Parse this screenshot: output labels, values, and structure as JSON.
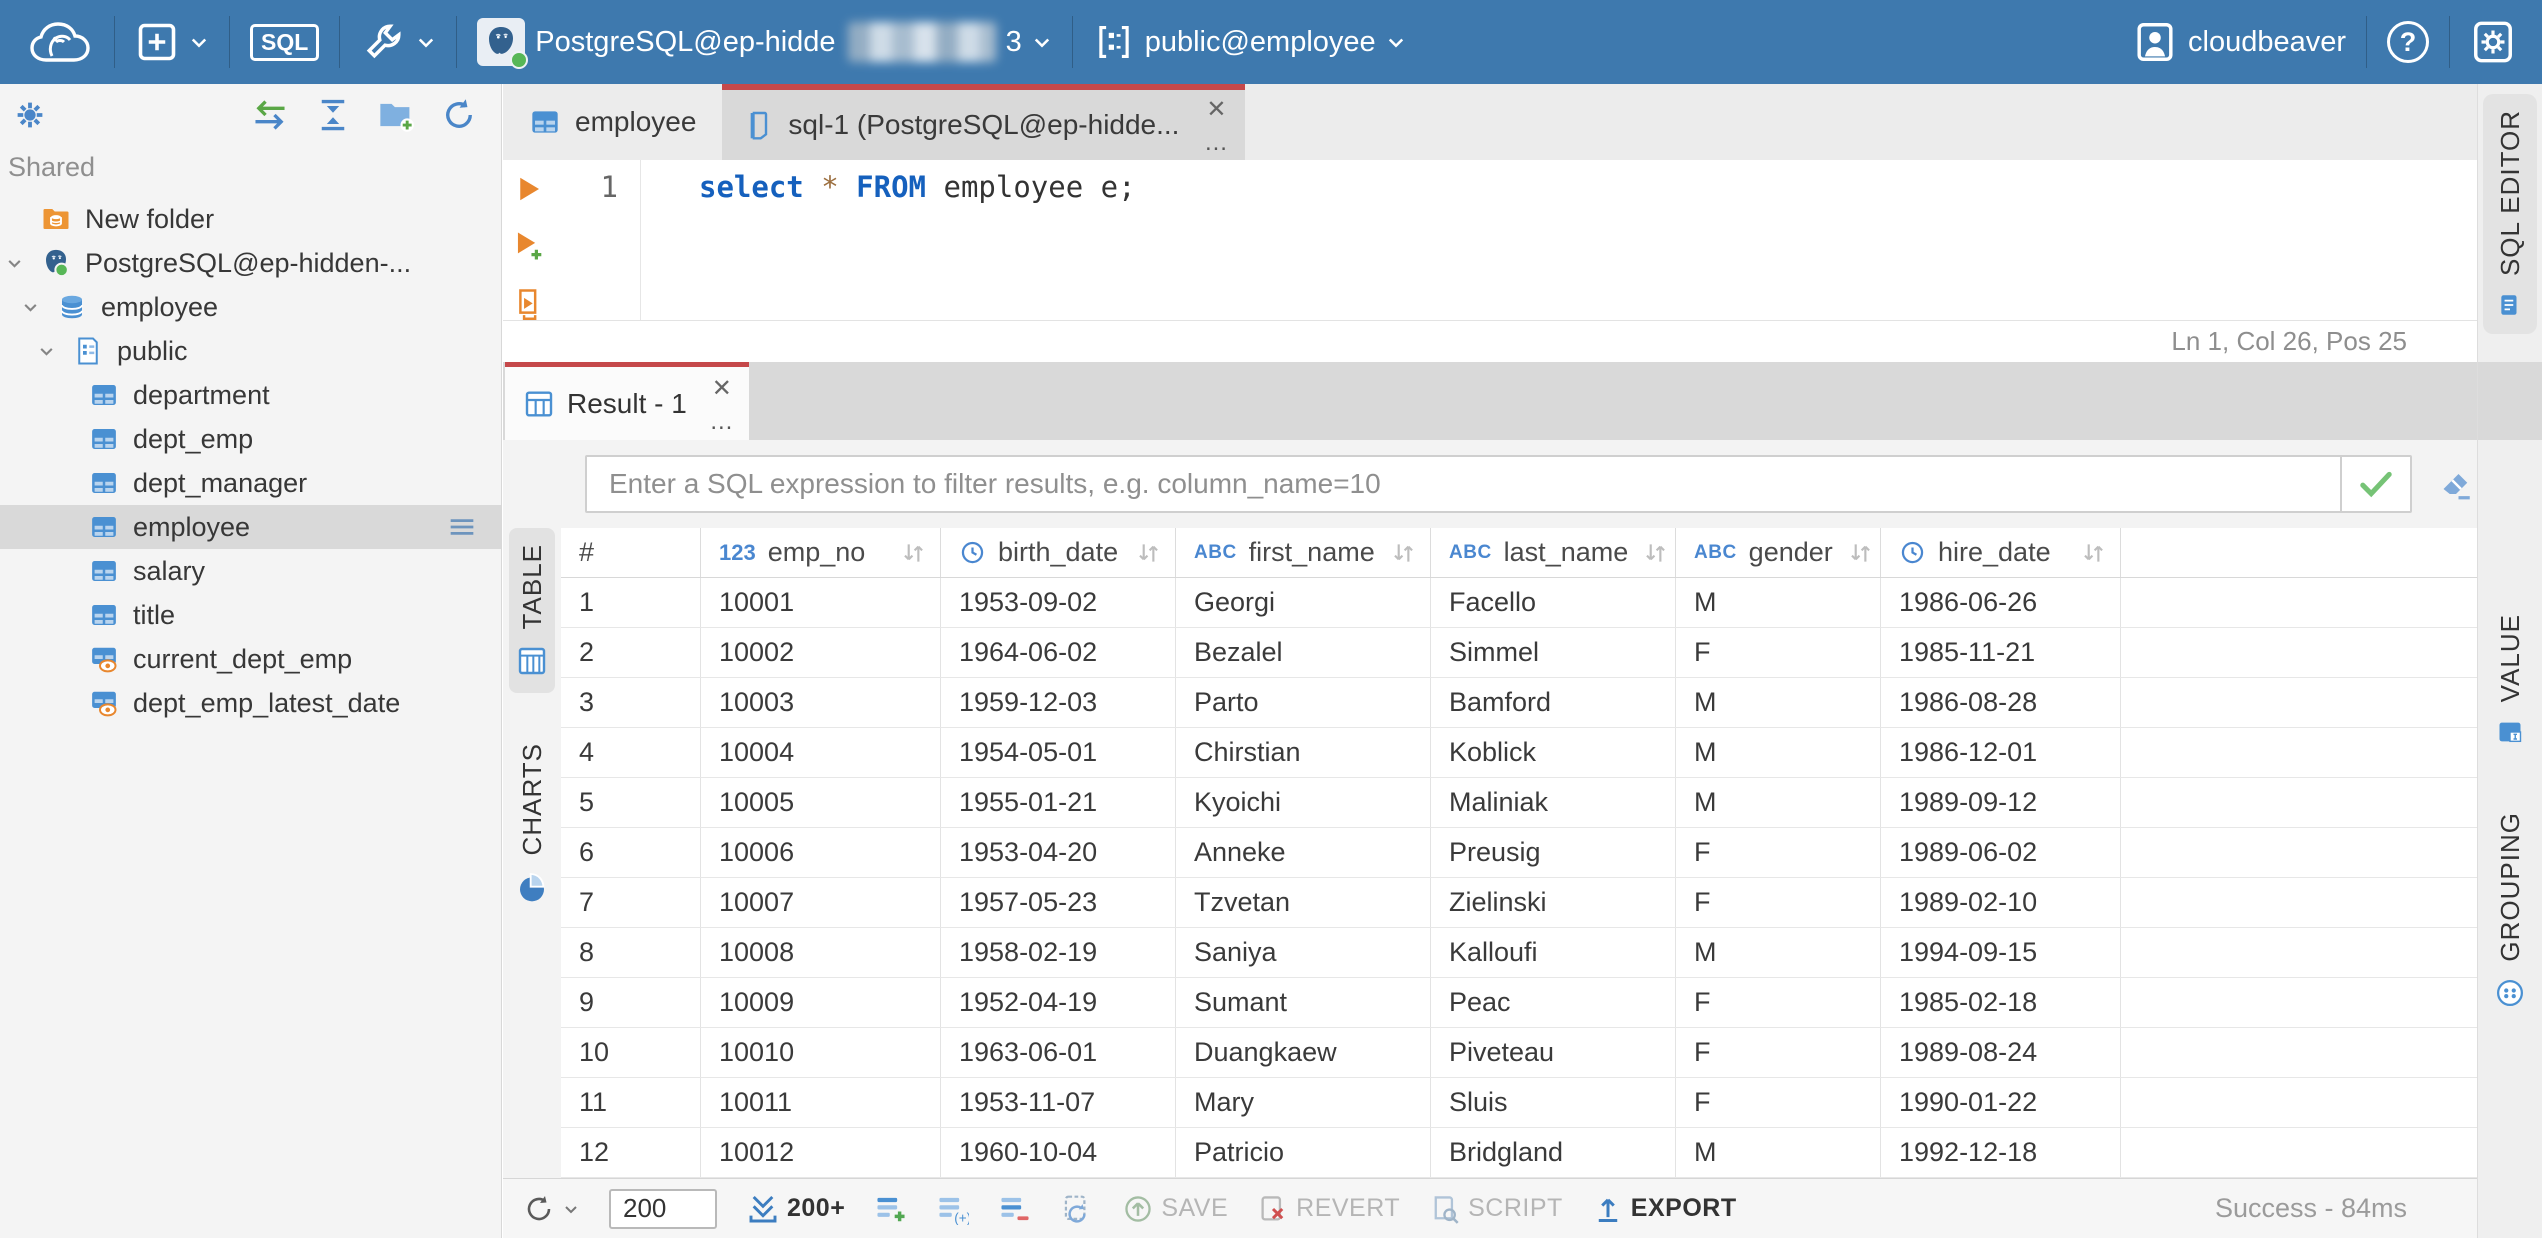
{
  "topbar": {
    "sql_badge": "SQL",
    "connection_label": "PostgreSQL@ep-hidde",
    "connection_tail": "3",
    "database_selector": "public@employee",
    "username": "cloudbeaver",
    "help_glyph": "?"
  },
  "sidebar": {
    "section_label": "Shared",
    "tree": [
      {
        "label": "New folder",
        "icon": "folder-db",
        "depth": 0,
        "chevron": false
      },
      {
        "label": "PostgreSQL@ep-hidden-...",
        "icon": "postgres",
        "depth": 0,
        "chevron": true
      },
      {
        "label": "employee",
        "icon": "database",
        "depth": 1,
        "chevron": true
      },
      {
        "label": "public",
        "icon": "schema",
        "depth": 2,
        "chevron": true
      },
      {
        "label": "department",
        "icon": "table",
        "depth": 3,
        "chevron": false
      },
      {
        "label": "dept_emp",
        "icon": "table",
        "depth": 3,
        "chevron": false
      },
      {
        "label": "dept_manager",
        "icon": "table",
        "depth": 3,
        "chevron": false
      },
      {
        "label": "employee",
        "icon": "table",
        "depth": 3,
        "chevron": false,
        "selected": true
      },
      {
        "label": "salary",
        "icon": "table",
        "depth": 3,
        "chevron": false
      },
      {
        "label": "title",
        "icon": "table",
        "depth": 3,
        "chevron": false
      },
      {
        "label": "current_dept_emp",
        "icon": "view",
        "depth": 3,
        "chevron": false
      },
      {
        "label": "dept_emp_latest_date",
        "icon": "view",
        "depth": 3,
        "chevron": false
      }
    ]
  },
  "editor": {
    "tabs": [
      {
        "label": "employee"
      },
      {
        "label": "sql-1 (PostgreSQL@ep-hidde..."
      }
    ],
    "close_glyph": "✕",
    "overflow_glyph": "...",
    "line_number": "1",
    "code": {
      "kw1": "select",
      "op": "*",
      "kw2": "FROM",
      "tail": "employee e;"
    },
    "status": "Ln 1, Col 26, Pos 25"
  },
  "results": {
    "tab_label": "Result - 1",
    "close_glyph": "✕",
    "overflow_glyph": "...",
    "filter_placeholder": "Enter a SQL expression to filter results, e.g. column_name=10",
    "left_tabs": [
      "TABLE",
      "CHARTS"
    ],
    "right_tabs": [
      "SQL EDITOR",
      "VALUE",
      "GROUPING"
    ],
    "table": {
      "index_header": "#",
      "type_badges": {
        "number": "123",
        "string": "ABC"
      },
      "columns": [
        {
          "name": "emp_no",
          "type": "number"
        },
        {
          "name": "birth_date",
          "type": "datetime"
        },
        {
          "name": "first_name",
          "type": "string"
        },
        {
          "name": "last_name",
          "type": "string"
        },
        {
          "name": "gender",
          "type": "string"
        },
        {
          "name": "hire_date",
          "type": "datetime"
        }
      ],
      "rows": [
        [
          "1",
          "10001",
          "1953-09-02",
          "Georgi",
          "Facello",
          "M",
          "1986-06-26"
        ],
        [
          "2",
          "10002",
          "1964-06-02",
          "Bezalel",
          "Simmel",
          "F",
          "1985-11-21"
        ],
        [
          "3",
          "10003",
          "1959-12-03",
          "Parto",
          "Bamford",
          "M",
          "1986-08-28"
        ],
        [
          "4",
          "10004",
          "1954-05-01",
          "Chirstian",
          "Koblick",
          "M",
          "1986-12-01"
        ],
        [
          "5",
          "10005",
          "1955-01-21",
          "Kyoichi",
          "Maliniak",
          "M",
          "1989-09-12"
        ],
        [
          "6",
          "10006",
          "1953-04-20",
          "Anneke",
          "Preusig",
          "F",
          "1989-06-02"
        ],
        [
          "7",
          "10007",
          "1957-05-23",
          "Tzvetan",
          "Zielinski",
          "F",
          "1989-02-10"
        ],
        [
          "8",
          "10008",
          "1958-02-19",
          "Saniya",
          "Kalloufi",
          "M",
          "1994-09-15"
        ],
        [
          "9",
          "10009",
          "1952-04-19",
          "Sumant",
          "Peac",
          "F",
          "1985-02-18"
        ],
        [
          "10",
          "10010",
          "1963-06-01",
          "Duangkaew",
          "Piveteau",
          "F",
          "1989-08-24"
        ],
        [
          "11",
          "10011",
          "1953-11-07",
          "Mary",
          "Sluis",
          "F",
          "1990-01-22"
        ],
        [
          "12",
          "10012",
          "1960-10-04",
          "Patricio",
          "Bridgland",
          "M",
          "1992-12-18"
        ]
      ]
    },
    "toolbar": {
      "limit_value": "200",
      "fetch_label": "200+",
      "save_label": "SAVE",
      "revert_label": "REVERT",
      "script_label": "SCRIPT",
      "export_label": "EXPORT",
      "status": "Success - 84ms"
    }
  },
  "colors": {
    "topbar_blue": "#3e79ae",
    "accent_blue": "#4a87d0",
    "active_tab_red": "#c5484a",
    "connection_ok_green": "#57b757",
    "run_orange": "#e8872e"
  }
}
